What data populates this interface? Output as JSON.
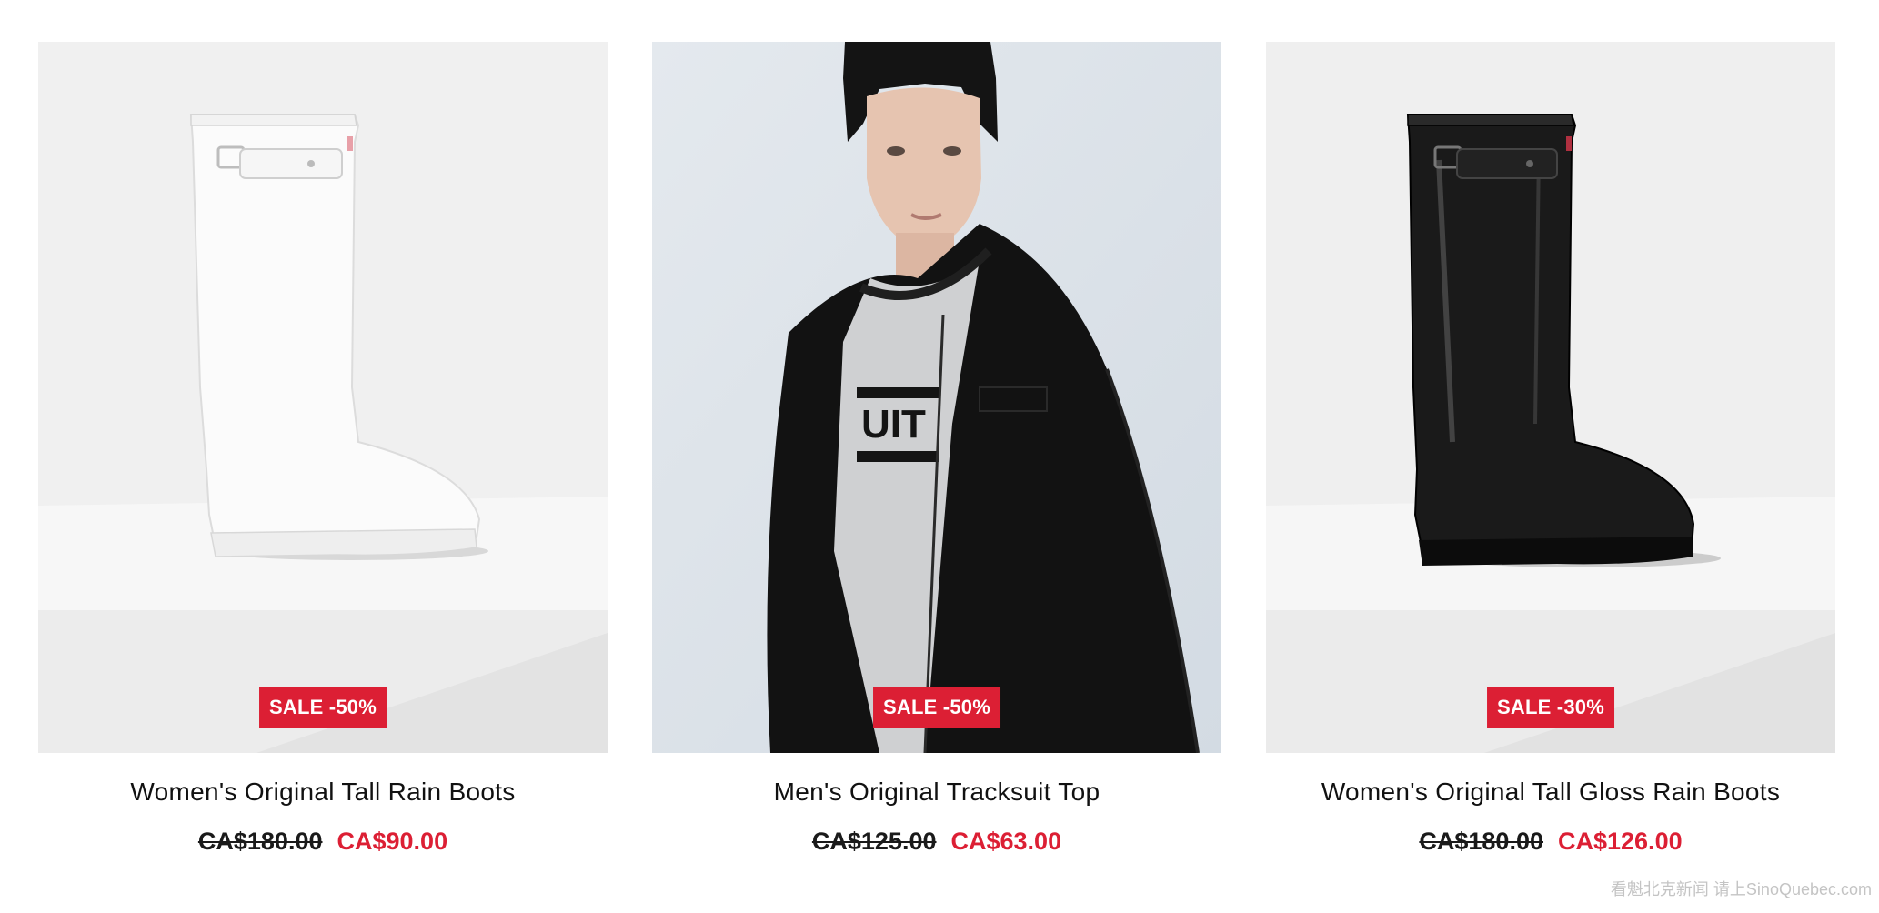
{
  "products": [
    {
      "name": "Women's Original Tall Rain Boots",
      "badge": "SALE -50%",
      "original_price": "CA$180.00",
      "sale_price": "CA$90.00",
      "image": "white-rain-boot"
    },
    {
      "name": "Men's Original Tracksuit Top",
      "badge": "SALE -50%",
      "original_price": "CA$125.00",
      "sale_price": "CA$63.00",
      "image": "model-black-tracksuit-top"
    },
    {
      "name": "Women's Original Tall Gloss Rain Boots",
      "badge": "SALE -30%",
      "original_price": "CA$180.00",
      "sale_price": "CA$126.00",
      "image": "black-gloss-rain-boot"
    }
  ],
  "watermark": "看魁北克新闻 请上SinoQuebec.com",
  "colors": {
    "sale_red": "#dc1f34",
    "text": "#111111",
    "background": "#ffffff"
  }
}
